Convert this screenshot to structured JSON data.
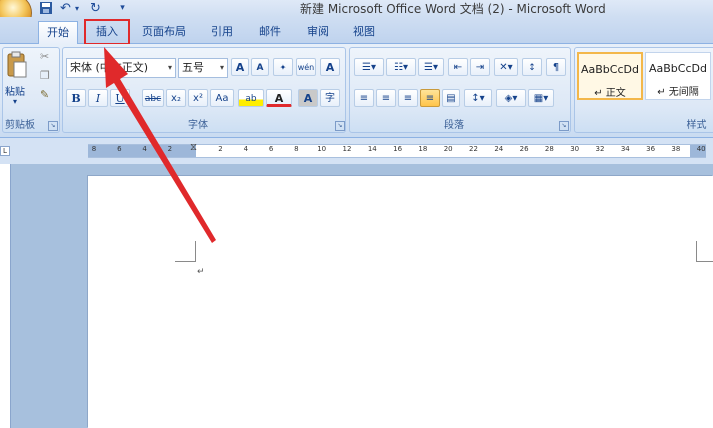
{
  "window": {
    "title": "新建 Microsoft Office Word 文档 (2) - Microsoft Word"
  },
  "qat": {
    "save_icon": "save-icon",
    "undo_icon": "undo-icon",
    "redo_icon": "redo-icon",
    "more": "▾"
  },
  "tabs": [
    {
      "label": "开始"
    },
    {
      "label": "插入"
    },
    {
      "label": "页面布局"
    },
    {
      "label": "引用"
    },
    {
      "label": "邮件"
    },
    {
      "label": "审阅"
    },
    {
      "label": "视图"
    }
  ],
  "clipboard": {
    "paste_label": "粘贴",
    "group_label": "剪贴板"
  },
  "font": {
    "font_name": "宋体 (中文正文)",
    "font_size": "五号",
    "group_label": "字体",
    "bold": "B",
    "italic": "I",
    "underline": "U",
    "strike": "abc",
    "subscript": "x₂",
    "superscript": "x²",
    "change_case": "Aa",
    "grow": "A",
    "shrink": "A",
    "phonetic": "wén",
    "highlight": "ab",
    "font_color": "A",
    "char_shade": "A",
    "enclose": "字"
  },
  "paragraph": {
    "group_label": "段落"
  },
  "styles": {
    "group_label": "样式",
    "items": [
      {
        "sample": "AaBbCcDd",
        "name": "↵ 正文"
      },
      {
        "sample": "AaBbCcDd",
        "name": "↵ 无间隔"
      }
    ]
  },
  "ruler": {
    "ticks": [
      "8",
      "6",
      "4",
      "2",
      "",
      "2",
      "4",
      "6",
      "8",
      "10",
      "12",
      "14",
      "16",
      "18",
      "20",
      "22",
      "24",
      "26",
      "28",
      "30",
      "32",
      "34",
      "36",
      "38",
      "40"
    ]
  },
  "document": {
    "paragraph_mark": "↵"
  },
  "colors": {
    "highlight_red": "#e0292b",
    "ribbon_text": "#15428b"
  }
}
